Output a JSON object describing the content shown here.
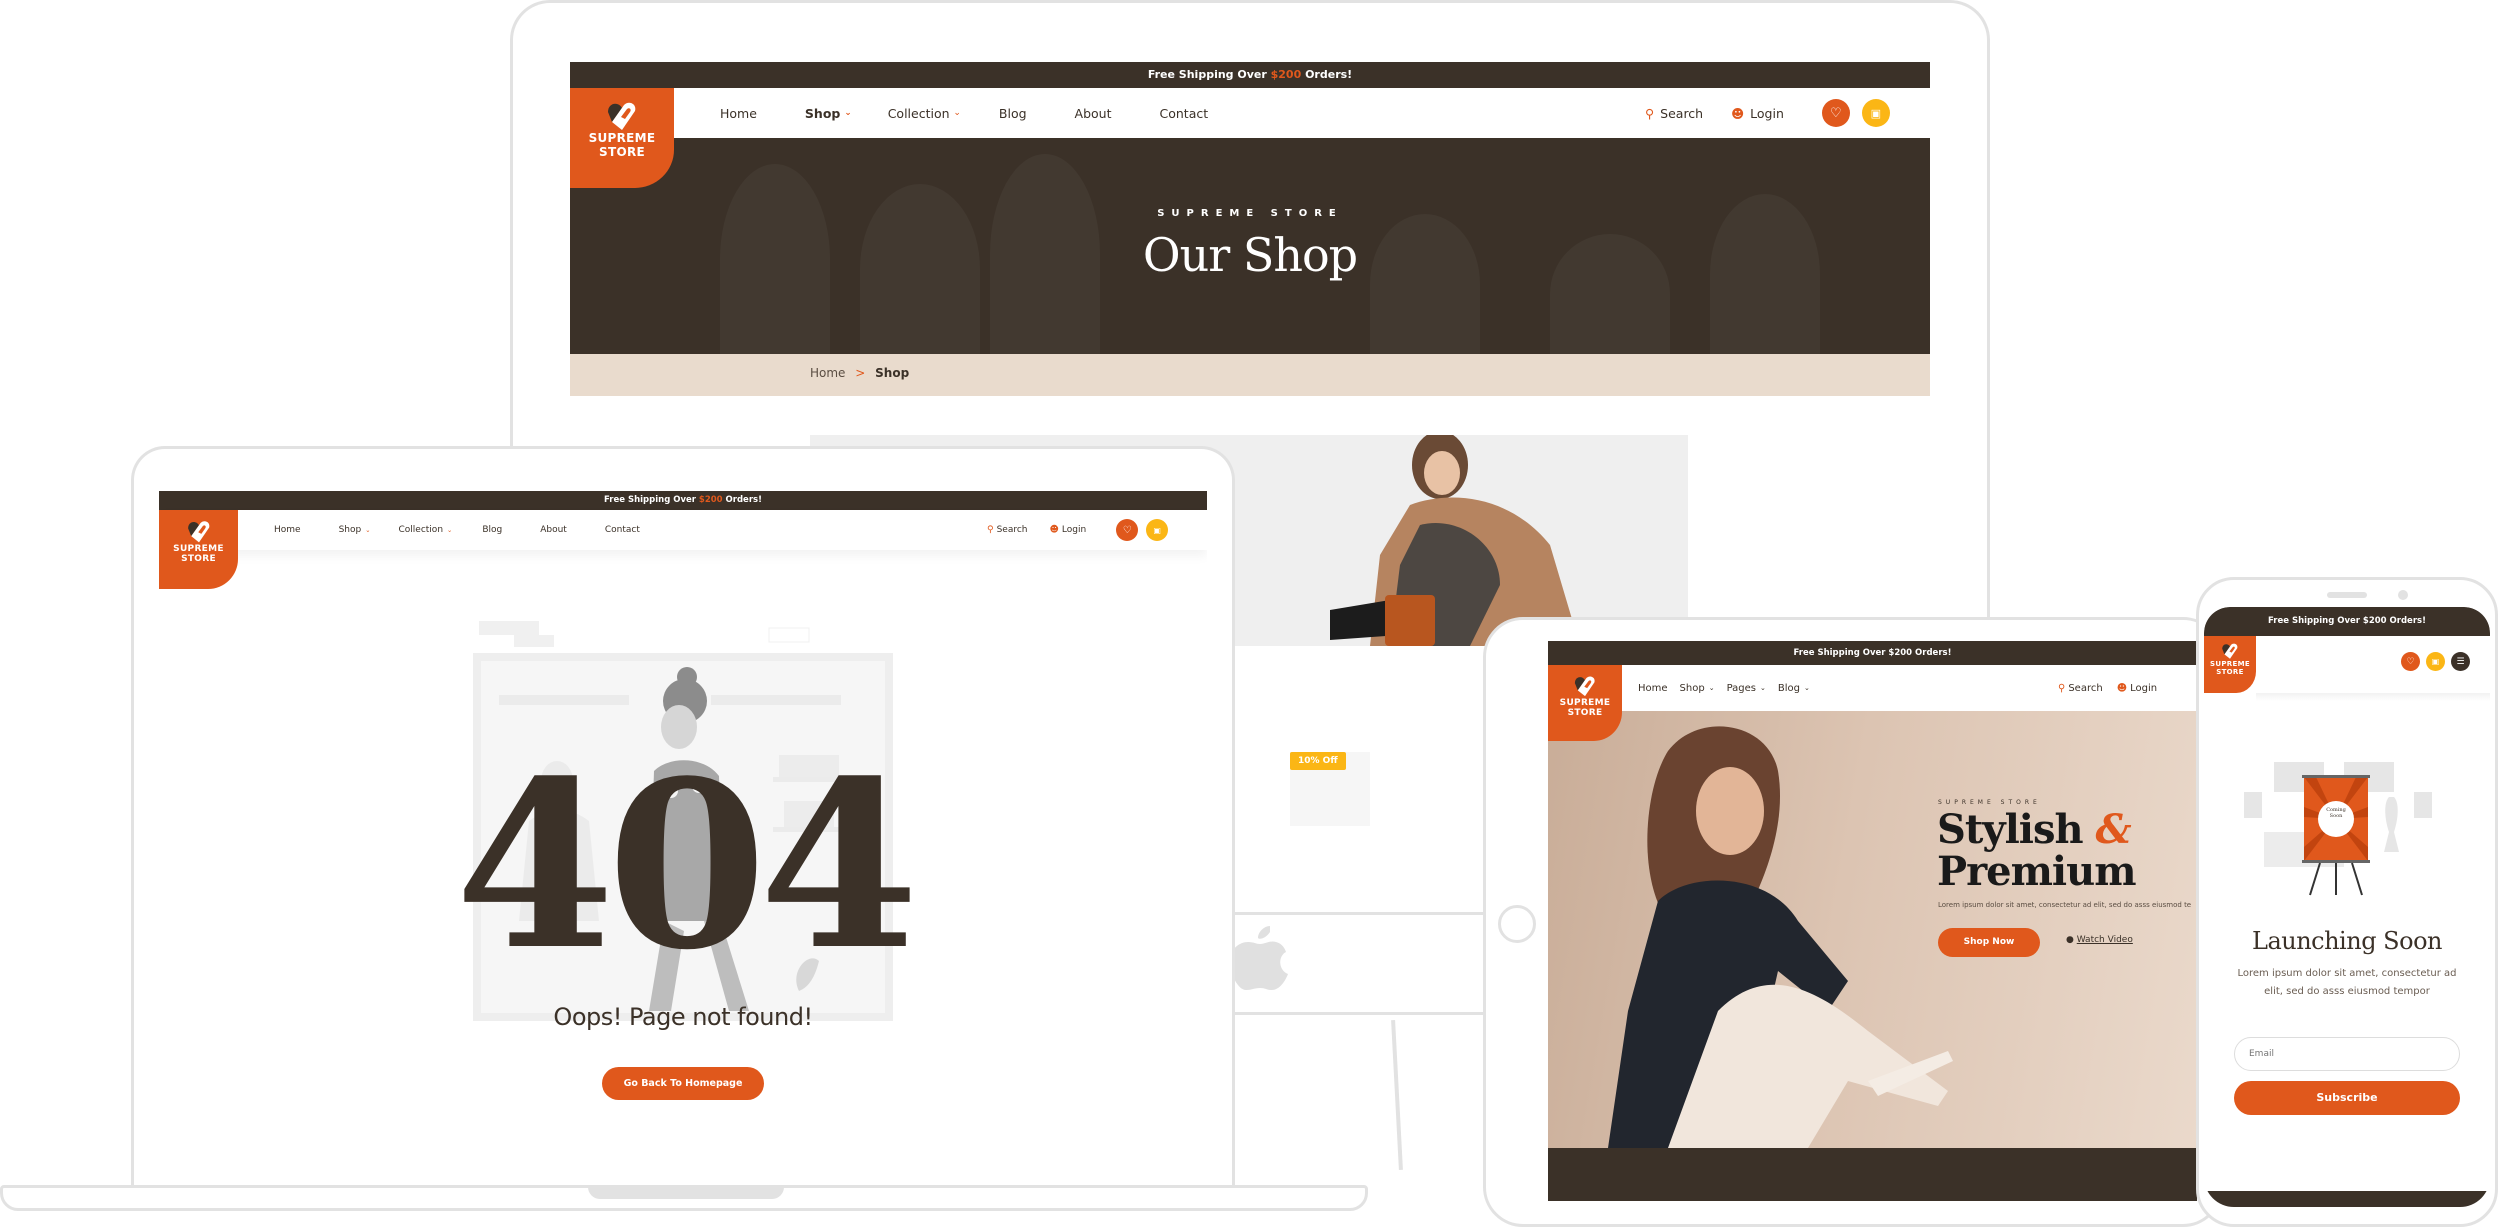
{
  "brand": {
    "name_line1": "SUPREME",
    "name_line2": "STORE",
    "colors": {
      "primary": "#e0581c",
      "secondary": "#fbb615",
      "dark": "#3b3128",
      "cream": "#e9dbcd"
    }
  },
  "announcement": {
    "prefix": "Free Shipping Over ",
    "amount": "$200",
    "suffix": " Orders!"
  },
  "desktop": {
    "nav": [
      {
        "label": "Home",
        "dropdown": false,
        "active": false
      },
      {
        "label": "Shop",
        "dropdown": true,
        "active": true
      },
      {
        "label": "Collection",
        "dropdown": true,
        "active": false
      },
      {
        "label": "Blog",
        "dropdown": false,
        "active": false
      },
      {
        "label": "About",
        "dropdown": false,
        "active": false
      },
      {
        "label": "Contact",
        "dropdown": false,
        "active": false
      }
    ],
    "search_label": "Search",
    "login_label": "Login",
    "hero": {
      "eyebrow": "SUPREME STORE",
      "title": "Our Shop"
    },
    "breadcrumb": {
      "home": "Home",
      "separator": ">",
      "current": "Shop"
    },
    "product_badge": "10% Off"
  },
  "laptop": {
    "error_code": "404",
    "message": "Oops! Page not found!",
    "button_label": "Go Back To Homepage"
  },
  "tablet": {
    "nav": [
      {
        "label": "Home",
        "dropdown": false
      },
      {
        "label": "Shop",
        "dropdown": true
      },
      {
        "label": "Pages",
        "dropdown": true
      },
      {
        "label": "Blog",
        "dropdown": true
      }
    ],
    "search_label": "Search",
    "login_label": "Login",
    "hero": {
      "eyebrow": "SUPREME STORE",
      "title_line1": "Stylish",
      "ampersand": "&",
      "title_line2": "Premium",
      "description": "Lorem ipsum dolor sit amet, consectetur ad elit, sed do asss eiusmod te",
      "cta_label": "Shop Now",
      "video_label": "Watch Video"
    }
  },
  "phone": {
    "poster_text": "Coming Soon",
    "title": "Launching Soon",
    "description": "Lorem ipsum dolor sit amet, consectetur ad elit, sed do asss eiusmod tempor",
    "email_placeholder": "Email",
    "subscribe_label": "Subscribe"
  },
  "icons": {
    "logo": "heart-tag-icon",
    "search": "search-icon",
    "login": "user-icon",
    "wishlist": "heart-icon",
    "cart": "shopping-bag-icon",
    "menu": "hamburger-menu-icon",
    "play": "play-circle-icon"
  }
}
